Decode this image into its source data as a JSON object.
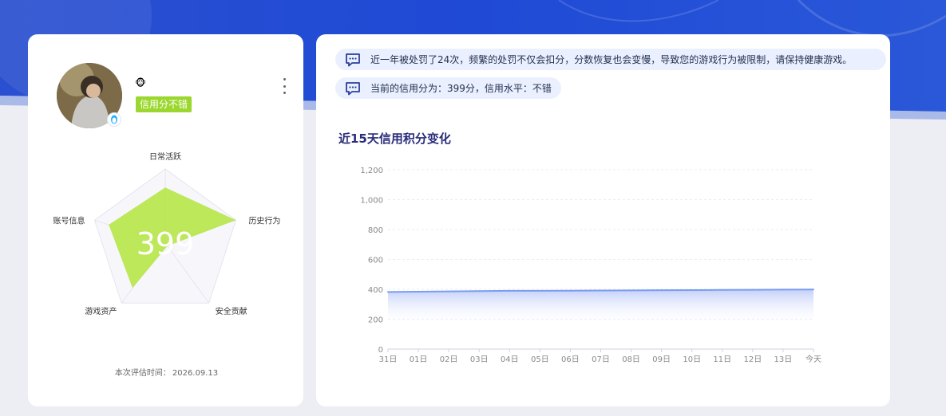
{
  "profile": {
    "credit_badge": "信用分不错",
    "avatar_icon": "qq-penguin-icon",
    "badge_icon": "monkey-icon",
    "eval_label": "本次评估时间：",
    "eval_date": "2026.09.13",
    "radar": {
      "score": "399",
      "axes": [
        "日常活跃",
        "历史行为",
        "安全贡献",
        "游戏资产",
        "账号信息"
      ],
      "values": [
        0.75,
        1.0,
        0.05,
        0.75,
        0.8
      ],
      "fill": "#b6e548"
    }
  },
  "notices": [
    {
      "icon": "chat-bubble-icon",
      "text": "近一年被处罚了24次，频繁的处罚不仅会扣分，分数恢复也会变慢，导致您的游戏行为被限制，请保持健康游戏。"
    },
    {
      "icon": "chat-bubble-icon",
      "text": "当前的信用分为：399分，信用水平：不错"
    }
  ],
  "chart_title": "近15天信用积分变化",
  "chart_data": {
    "type": "area",
    "title": "近15天信用积分变化",
    "categories": [
      "31日",
      "01日",
      "02日",
      "03日",
      "04日",
      "05日",
      "06日",
      "07日",
      "08日",
      "09日",
      "10日",
      "11日",
      "12日",
      "13日",
      "今天"
    ],
    "values": [
      382,
      384,
      386,
      388,
      390,
      390,
      391,
      392,
      393,
      394,
      395,
      396,
      397,
      398,
      399
    ],
    "ylim": [
      0,
      1200
    ],
    "yticks": [
      "0",
      "200",
      "400",
      "600",
      "800",
      "1,000",
      "1,200"
    ],
    "xlabel": "",
    "ylabel": "",
    "grid": true,
    "line_color": "#7b9cf0"
  }
}
